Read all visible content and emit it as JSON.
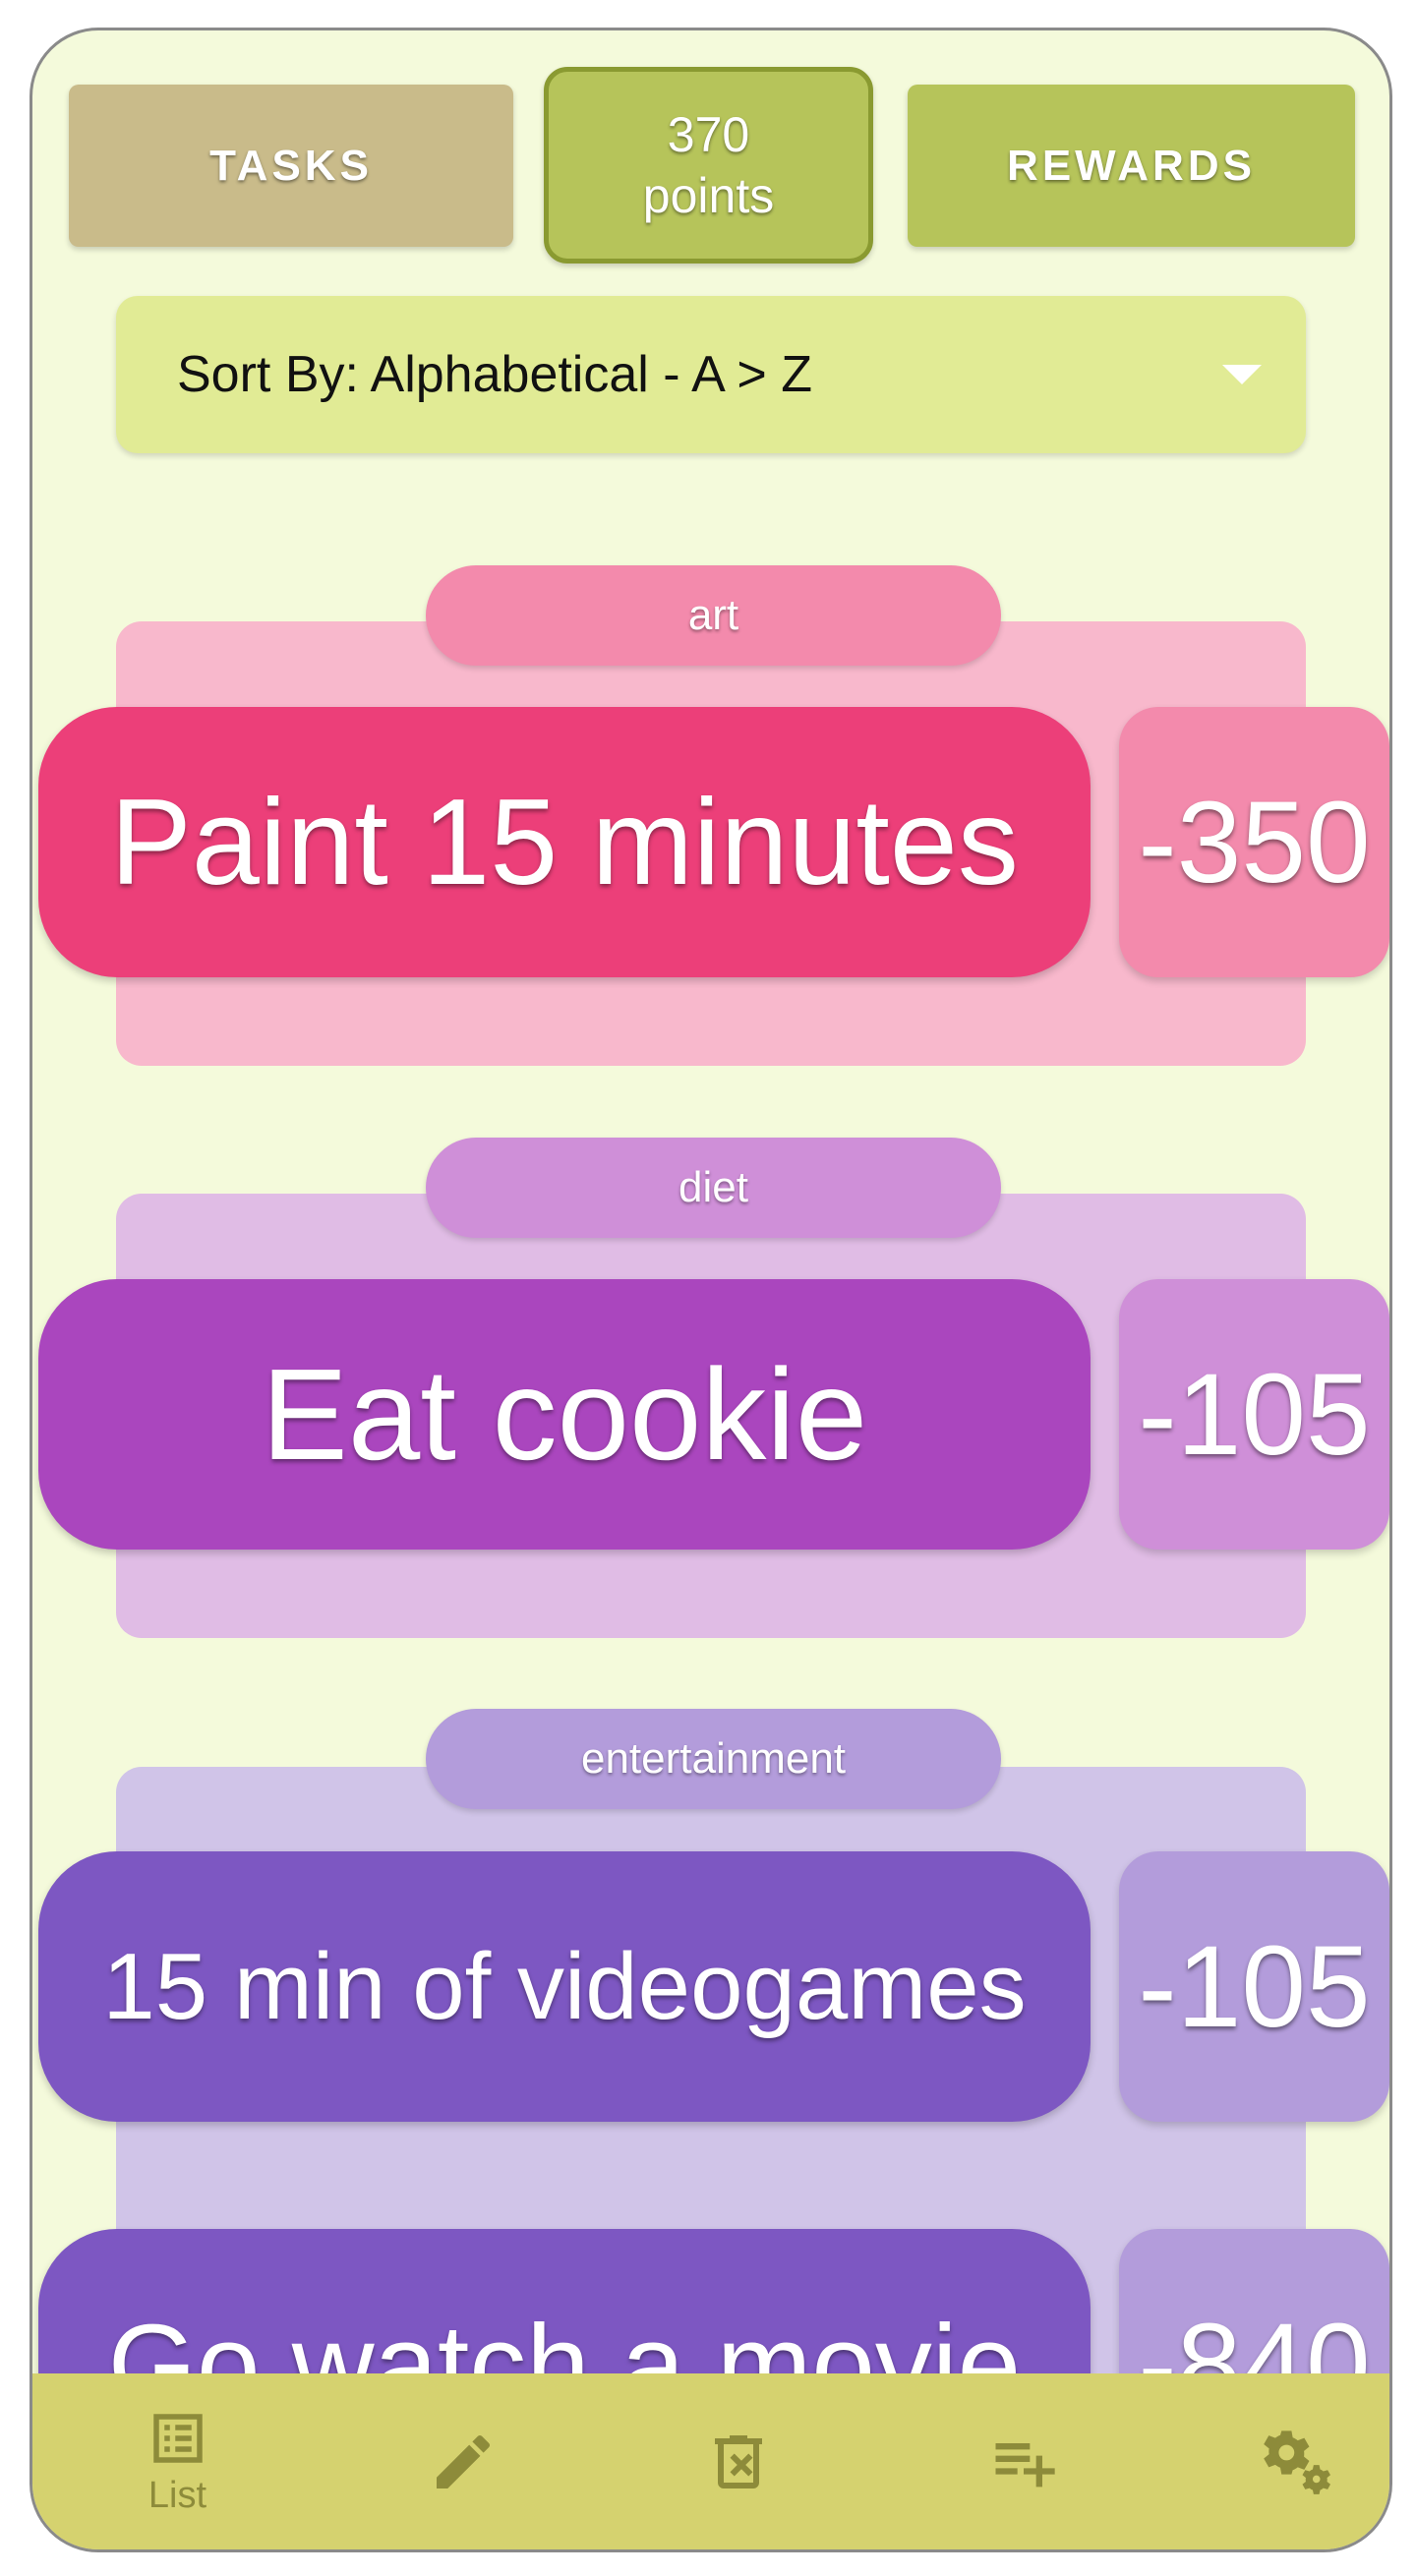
{
  "header": {
    "tasks_label": "TASKS",
    "points_value": "370",
    "points_unit": "points",
    "rewards_label": "REWARDS"
  },
  "sort": {
    "label": "Sort By: Alphabetical - A > Z",
    "icon": "dropdown-arrow-icon"
  },
  "categories": [
    {
      "name": "art",
      "color": "#f8b8cc",
      "pill_color": "#f38aac",
      "rewards": [
        {
          "title": "Paint 15 minutes",
          "cost": "-350",
          "color": "#ec3f79",
          "cost_color": "#f38aac"
        }
      ]
    },
    {
      "name": "diet",
      "color": "#e0bce5",
      "pill_color": "#cf8fd8",
      "rewards": [
        {
          "title": "Eat cookie",
          "cost": "-105",
          "color": "#aa46be",
          "cost_color": "#cf8fd8"
        }
      ]
    },
    {
      "name": "entertainment",
      "color": "#d0c4e8",
      "pill_color": "#b39cdb",
      "rewards": [
        {
          "title": "15 min of videogames",
          "cost": "-105",
          "color": "#7d57c2",
          "cost_color": "#b39cdb"
        },
        {
          "title": "Go watch a movie",
          "cost": "-840",
          "color": "#7d57c2",
          "cost_color": "#b39cdb"
        }
      ]
    }
  ],
  "bottom_nav": {
    "items": [
      {
        "icon": "list-icon",
        "label": "List"
      },
      {
        "icon": "edit-icon",
        "label": ""
      },
      {
        "icon": "delete-icon",
        "label": ""
      },
      {
        "icon": "playlist-add-icon",
        "label": ""
      },
      {
        "icon": "settings-icon",
        "label": ""
      }
    ],
    "color": "#d5d26f",
    "icon_color": "#8d8b3a"
  }
}
